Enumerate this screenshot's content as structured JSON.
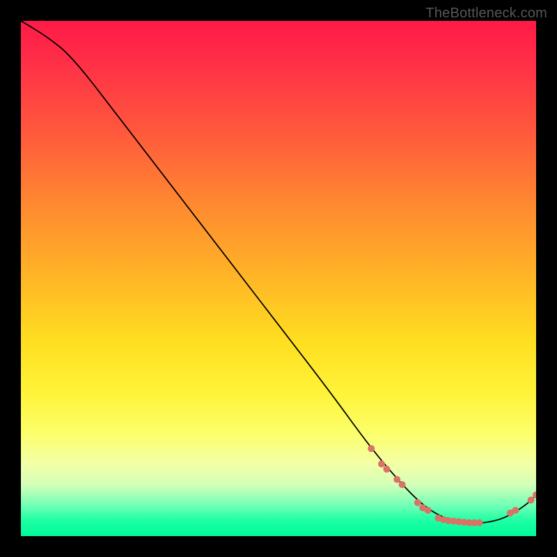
{
  "watermark": "TheBottleneck.com",
  "chart_data": {
    "type": "line",
    "title": "",
    "xlabel": "",
    "ylabel": "",
    "xlim": [
      0,
      100
    ],
    "ylim": [
      0,
      100
    ],
    "grid": false,
    "curve": {
      "x": [
        0,
        5,
        10,
        20,
        30,
        40,
        50,
        60,
        68,
        74,
        78,
        82,
        86,
        90,
        94,
        98,
        100
      ],
      "y": [
        100,
        97,
        93,
        80,
        67,
        54,
        41,
        28,
        17,
        10,
        6,
        3.5,
        2.5,
        2.5,
        3.5,
        6,
        8
      ]
    },
    "scatter": {
      "x": [
        68,
        70,
        71,
        73,
        74,
        77,
        78,
        79,
        81,
        82,
        83,
        84,
        85,
        86,
        87,
        88,
        89,
        95,
        96,
        99,
        100
      ],
      "y": [
        17,
        14,
        13,
        11,
        10,
        6.5,
        5.5,
        5,
        3.5,
        3.2,
        3,
        2.9,
        2.8,
        2.7,
        2.6,
        2.6,
        2.6,
        4.5,
        5,
        7,
        8
      ]
    }
  }
}
